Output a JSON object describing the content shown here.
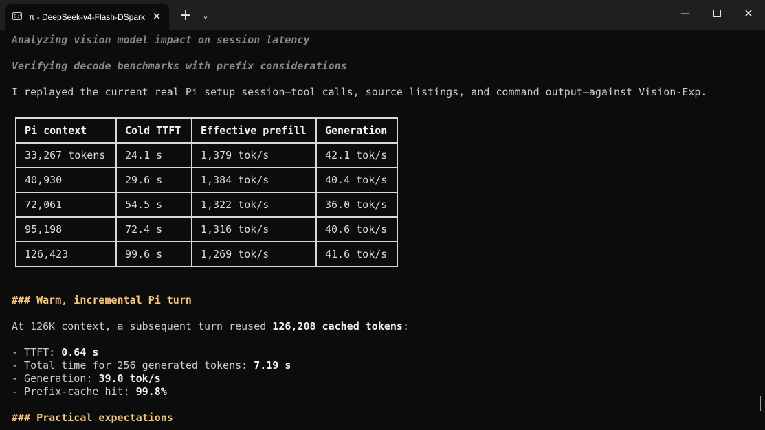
{
  "tab": {
    "icon_glyph": "C:\\",
    "title": "π - DeepSeek-v4-Flash-DSpark",
    "close_glyph": "✕"
  },
  "toolbar": {
    "new_tab_glyph": "+",
    "dropdown_glyph": "⌄"
  },
  "window": {
    "minimize_glyph": "—",
    "close_glyph": "✕"
  },
  "terminal": {
    "thinking_1": "Analyzing vision model impact on session latency",
    "thinking_2": "Verifying decode benchmarks with prefix considerations",
    "intro": "I replayed the current real Pi setup session—tool calls, source listings, and command output—against Vision-Exp.",
    "table": {
      "headers": [
        "Pi context",
        "Cold TTFT",
        "Effective prefill",
        "Generation"
      ],
      "rows": [
        [
          "33,267 tokens",
          "24.1 s",
          "1,379 tok/s",
          "42.1 tok/s"
        ],
        [
          "40,930",
          "29.6 s",
          "1,384 tok/s",
          "40.4 tok/s"
        ],
        [
          "72,061",
          "54.5 s",
          "1,322 tok/s",
          "36.0 tok/s"
        ],
        [
          "95,198",
          "72.4 s",
          "1,316 tok/s",
          "40.6 tok/s"
        ],
        [
          "126,423",
          "99.6 s",
          "1,269 tok/s",
          "41.6 tok/s"
        ]
      ]
    },
    "heading_1": "### Warm, incremental Pi turn",
    "warm_prefix": "At 126K context, a subsequent turn reused ",
    "warm_bold": "126,208 cached tokens",
    "warm_suffix": ":",
    "bullets": [
      {
        "label": "- TTFT: ",
        "value": "0.64 s"
      },
      {
        "label": "- Total time for 256 generated tokens: ",
        "value": "7.19 s"
      },
      {
        "label": "- Generation: ",
        "value": "39.0 tok/s"
      },
      {
        "label": "- Prefix-cache hit: ",
        "value": "99.8%"
      }
    ],
    "heading_2": "### Practical expectations"
  },
  "colors": {
    "background": "#0c0c0c",
    "titlebar": "#1f1f1f",
    "heading": "#f5c57a",
    "thinking": "#8a8a8a"
  }
}
